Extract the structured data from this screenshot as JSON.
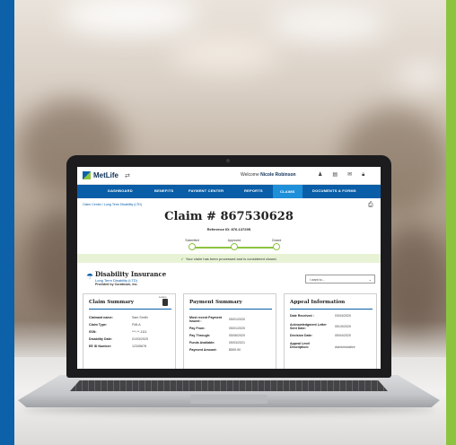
{
  "app": {
    "logo_text": "MetLife",
    "welcome_prefix": "Welcome",
    "user_name": "Nicole Robinson",
    "header_icons": [
      "user-icon",
      "document-icon",
      "mail-icon",
      "lock-icon"
    ]
  },
  "nav": {
    "items": [
      {
        "label": "DASHBOARD"
      },
      {
        "label": "BENEFITS"
      },
      {
        "label": "PAYMENT CENTER"
      },
      {
        "label": "REPORTS"
      },
      {
        "label": "CLAIMS",
        "active": true
      },
      {
        "label": "DOCUMENTS & FORMS"
      }
    ]
  },
  "breadcrumb": {
    "text": "Claim Center / Long Term Disability (LTD)"
  },
  "claim": {
    "title": "Claim # 867530628",
    "reference": "Reference ID: 876-13729S"
  },
  "progress": {
    "steps": [
      {
        "label": "Submitted"
      },
      {
        "label": "Approved"
      },
      {
        "label": "Closed"
      }
    ]
  },
  "banner": {
    "text": "Your claim has been processed and is considered closed."
  },
  "coverage": {
    "title": "Disability Insurance",
    "subtitle": "Long Term Disability (LTD)",
    "provider": "Provided by Curaticum, Inc.",
    "select_placeholder": "I want to..."
  },
  "claim_summary": {
    "title": "Claim Summary",
    "doc_label": "Letters",
    "rows": [
      {
        "k": "Claimant name:",
        "v": "Sam Smith"
      },
      {
        "k": "Claim Type:",
        "v": "FMLA"
      },
      {
        "k": "SSN:",
        "v": "***-**-1111"
      },
      {
        "k": "Disability Date:",
        "v": "01/03/2020"
      },
      {
        "k": "EE ID Number:",
        "v": "12345678"
      }
    ]
  },
  "payment_summary": {
    "title": "Payment Summary",
    "rows": [
      {
        "k": "Most recent Payment Issued :",
        "v": "05/01/2020"
      },
      {
        "k": "Pay From:",
        "v": "05/01/2020"
      },
      {
        "k": "Pay Through:",
        "v": "05/06/2020"
      },
      {
        "k": "Funds Available:",
        "v": "05/03/2021"
      },
      {
        "k": "Payment Amount:",
        "v": "$559.90"
      }
    ]
  },
  "appeal_info": {
    "title": "Appeal Information",
    "rows": [
      {
        "k": "Date Received :",
        "v": "03/04/2020"
      },
      {
        "k": "Acknowledgment Letter Sent Date:",
        "v": "05/19/2020"
      },
      {
        "k": "Decision Date:",
        "v": "05/04/2020"
      },
      {
        "k": "Appeal Level Description:",
        "v": "Administrative"
      }
    ]
  },
  "colors": {
    "brand_blue": "#0a5ea8",
    "brand_green": "#8cc440",
    "nav_active": "#1e8fd9"
  }
}
